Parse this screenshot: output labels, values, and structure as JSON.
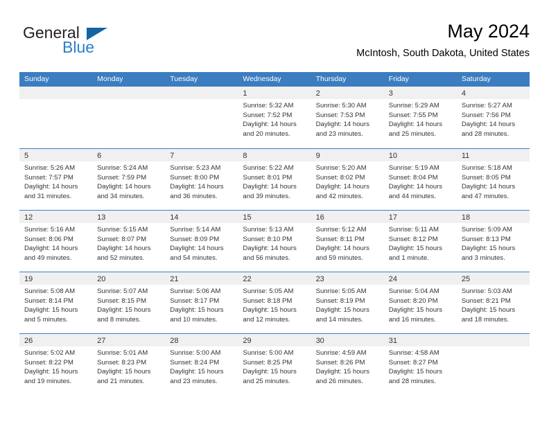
{
  "logo": {
    "word_one": "General",
    "word_two": "Blue",
    "triangle": "blue-triangle"
  },
  "header": {
    "title": "May 2024",
    "subtitle": "McIntosh, South Dakota, United States"
  },
  "colors": {
    "header_bar": "#3b7dc0",
    "day_band": "#f0f0f0",
    "logo_blue": "#2a7fc9",
    "logo_dark": "#231f20",
    "text": "#333333"
  },
  "calendar": {
    "weekdays": [
      "Sunday",
      "Monday",
      "Tuesday",
      "Wednesday",
      "Thursday",
      "Friday",
      "Saturday"
    ],
    "weeks": [
      [
        {
          "day": "",
          "lines": []
        },
        {
          "day": "",
          "lines": []
        },
        {
          "day": "",
          "lines": []
        },
        {
          "day": "1",
          "lines": [
            "Sunrise: 5:32 AM",
            "Sunset: 7:52 PM",
            "Daylight: 14 hours",
            "and 20 minutes."
          ]
        },
        {
          "day": "2",
          "lines": [
            "Sunrise: 5:30 AM",
            "Sunset: 7:53 PM",
            "Daylight: 14 hours",
            "and 23 minutes."
          ]
        },
        {
          "day": "3",
          "lines": [
            "Sunrise: 5:29 AM",
            "Sunset: 7:55 PM",
            "Daylight: 14 hours",
            "and 25 minutes."
          ]
        },
        {
          "day": "4",
          "lines": [
            "Sunrise: 5:27 AM",
            "Sunset: 7:56 PM",
            "Daylight: 14 hours",
            "and 28 minutes."
          ]
        }
      ],
      [
        {
          "day": "5",
          "lines": [
            "Sunrise: 5:26 AM",
            "Sunset: 7:57 PM",
            "Daylight: 14 hours",
            "and 31 minutes."
          ]
        },
        {
          "day": "6",
          "lines": [
            "Sunrise: 5:24 AM",
            "Sunset: 7:59 PM",
            "Daylight: 14 hours",
            "and 34 minutes."
          ]
        },
        {
          "day": "7",
          "lines": [
            "Sunrise: 5:23 AM",
            "Sunset: 8:00 PM",
            "Daylight: 14 hours",
            "and 36 minutes."
          ]
        },
        {
          "day": "8",
          "lines": [
            "Sunrise: 5:22 AM",
            "Sunset: 8:01 PM",
            "Daylight: 14 hours",
            "and 39 minutes."
          ]
        },
        {
          "day": "9",
          "lines": [
            "Sunrise: 5:20 AM",
            "Sunset: 8:02 PM",
            "Daylight: 14 hours",
            "and 42 minutes."
          ]
        },
        {
          "day": "10",
          "lines": [
            "Sunrise: 5:19 AM",
            "Sunset: 8:04 PM",
            "Daylight: 14 hours",
            "and 44 minutes."
          ]
        },
        {
          "day": "11",
          "lines": [
            "Sunrise: 5:18 AM",
            "Sunset: 8:05 PM",
            "Daylight: 14 hours",
            "and 47 minutes."
          ]
        }
      ],
      [
        {
          "day": "12",
          "lines": [
            "Sunrise: 5:16 AM",
            "Sunset: 8:06 PM",
            "Daylight: 14 hours",
            "and 49 minutes."
          ]
        },
        {
          "day": "13",
          "lines": [
            "Sunrise: 5:15 AM",
            "Sunset: 8:07 PM",
            "Daylight: 14 hours",
            "and 52 minutes."
          ]
        },
        {
          "day": "14",
          "lines": [
            "Sunrise: 5:14 AM",
            "Sunset: 8:09 PM",
            "Daylight: 14 hours",
            "and 54 minutes."
          ]
        },
        {
          "day": "15",
          "lines": [
            "Sunrise: 5:13 AM",
            "Sunset: 8:10 PM",
            "Daylight: 14 hours",
            "and 56 minutes."
          ]
        },
        {
          "day": "16",
          "lines": [
            "Sunrise: 5:12 AM",
            "Sunset: 8:11 PM",
            "Daylight: 14 hours",
            "and 59 minutes."
          ]
        },
        {
          "day": "17",
          "lines": [
            "Sunrise: 5:11 AM",
            "Sunset: 8:12 PM",
            "Daylight: 15 hours",
            "and 1 minute."
          ]
        },
        {
          "day": "18",
          "lines": [
            "Sunrise: 5:09 AM",
            "Sunset: 8:13 PM",
            "Daylight: 15 hours",
            "and 3 minutes."
          ]
        }
      ],
      [
        {
          "day": "19",
          "lines": [
            "Sunrise: 5:08 AM",
            "Sunset: 8:14 PM",
            "Daylight: 15 hours",
            "and 5 minutes."
          ]
        },
        {
          "day": "20",
          "lines": [
            "Sunrise: 5:07 AM",
            "Sunset: 8:15 PM",
            "Daylight: 15 hours",
            "and 8 minutes."
          ]
        },
        {
          "day": "21",
          "lines": [
            "Sunrise: 5:06 AM",
            "Sunset: 8:17 PM",
            "Daylight: 15 hours",
            "and 10 minutes."
          ]
        },
        {
          "day": "22",
          "lines": [
            "Sunrise: 5:05 AM",
            "Sunset: 8:18 PM",
            "Daylight: 15 hours",
            "and 12 minutes."
          ]
        },
        {
          "day": "23",
          "lines": [
            "Sunrise: 5:05 AM",
            "Sunset: 8:19 PM",
            "Daylight: 15 hours",
            "and 14 minutes."
          ]
        },
        {
          "day": "24",
          "lines": [
            "Sunrise: 5:04 AM",
            "Sunset: 8:20 PM",
            "Daylight: 15 hours",
            "and 16 minutes."
          ]
        },
        {
          "day": "25",
          "lines": [
            "Sunrise: 5:03 AM",
            "Sunset: 8:21 PM",
            "Daylight: 15 hours",
            "and 18 minutes."
          ]
        }
      ],
      [
        {
          "day": "26",
          "lines": [
            "Sunrise: 5:02 AM",
            "Sunset: 8:22 PM",
            "Daylight: 15 hours",
            "and 19 minutes."
          ]
        },
        {
          "day": "27",
          "lines": [
            "Sunrise: 5:01 AM",
            "Sunset: 8:23 PM",
            "Daylight: 15 hours",
            "and 21 minutes."
          ]
        },
        {
          "day": "28",
          "lines": [
            "Sunrise: 5:00 AM",
            "Sunset: 8:24 PM",
            "Daylight: 15 hours",
            "and 23 minutes."
          ]
        },
        {
          "day": "29",
          "lines": [
            "Sunrise: 5:00 AM",
            "Sunset: 8:25 PM",
            "Daylight: 15 hours",
            "and 25 minutes."
          ]
        },
        {
          "day": "30",
          "lines": [
            "Sunrise: 4:59 AM",
            "Sunset: 8:26 PM",
            "Daylight: 15 hours",
            "and 26 minutes."
          ]
        },
        {
          "day": "31",
          "lines": [
            "Sunrise: 4:58 AM",
            "Sunset: 8:27 PM",
            "Daylight: 15 hours",
            "and 28 minutes."
          ]
        },
        {
          "day": "",
          "lines": []
        }
      ]
    ]
  }
}
